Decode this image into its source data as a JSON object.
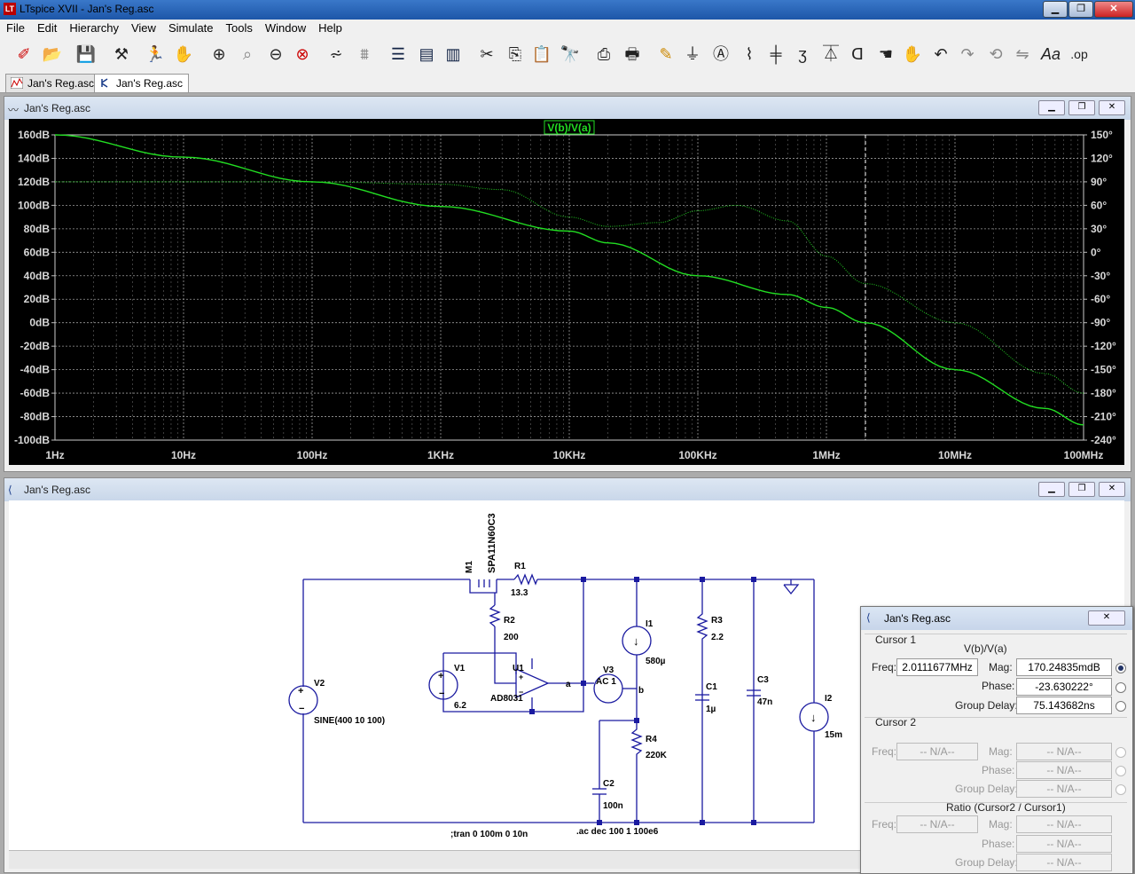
{
  "window": {
    "title": "LTspice XVII - Jan's Reg.asc",
    "app_icon": "LT"
  },
  "menu": [
    "File",
    "Edit",
    "Hierarchy",
    "View",
    "Simulate",
    "Tools",
    "Window",
    "Help"
  ],
  "toolbar_icons": [
    "new-schematic-icon",
    "open-icon",
    "save-icon",
    "control-panel-icon",
    "run-icon",
    "halt-icon",
    "zoom-in-icon",
    "zoom-pan-icon",
    "zoom-out-icon",
    "zoom-cancel-icon",
    "autorange-icon",
    "fft-icon",
    "tile-horizontal-icon",
    "cascade-icon",
    "tile-vertical-icon",
    "cut-icon",
    "copy-icon",
    "paste-icon",
    "find-icon",
    "print-setup-icon",
    "print-icon",
    "draw-wire-icon",
    "ground-icon",
    "label-net-icon",
    "resistor-icon",
    "capacitor-icon",
    "inductor-icon",
    "diode-icon",
    "component-icon",
    "move-icon",
    "drag-icon",
    "undo-icon",
    "redo-icon",
    "rotate-icon",
    "mirror-icon",
    "text-icon",
    "spice-directive-icon"
  ],
  "tabs": [
    {
      "label": "Jan's Reg.asc"
    },
    {
      "label": "Jan's Reg.asc"
    }
  ],
  "plot_window": {
    "title": "Jan's Reg.asc"
  },
  "schematic_window": {
    "title": "Jan's Reg.asc"
  },
  "chart_data": {
    "type": "line",
    "title": "V(b)/V(a)",
    "x_scale": "log",
    "xlim": [
      1,
      100000000
    ],
    "x_ticks": [
      "1Hz",
      "10Hz",
      "100Hz",
      "1KHz",
      "10KHz",
      "100KHz",
      "1MHz",
      "10MHz",
      "100MHz"
    ],
    "y_left_ticks": [
      "160dB",
      "140dB",
      "120dB",
      "100dB",
      "80dB",
      "60dB",
      "40dB",
      "20dB",
      "0dB",
      "-20dB",
      "-40dB",
      "-60dB",
      "-80dB",
      "-100dB"
    ],
    "y_right_ticks": [
      "150°",
      "120°",
      "90°",
      "60°",
      "30°",
      "0°",
      "-30°",
      "-60°",
      "-90°",
      "-120°",
      "-150°",
      "-180°",
      "-210°",
      "-240°"
    ],
    "ylim_left": [
      -100,
      160
    ],
    "ylim_right": [
      -240,
      150
    ],
    "grid": true,
    "cursor_x": 2011167.7,
    "series": [
      {
        "name": "magnitude",
        "axis": "left",
        "style": "solid",
        "color": "#22dd22",
        "x": [
          1,
          10,
          100,
          1000,
          10000,
          20000,
          100000,
          500000,
          1000000,
          2000000,
          10000000,
          50000000,
          100000000
        ],
        "y": [
          160,
          141,
          120,
          99,
          78,
          68,
          40,
          24,
          13,
          0,
          -40,
          -73,
          -87
        ]
      },
      {
        "name": "phase",
        "axis": "right",
        "style": "dotted",
        "color": "#22cc22",
        "x": [
          1,
          10,
          100,
          1000,
          3000,
          10000,
          20000,
          50000,
          100000,
          200000,
          500000,
          1000000,
          2000000,
          10000000,
          50000000,
          100000000
        ],
        "y": [
          90,
          90,
          90,
          87,
          80,
          45,
          33,
          38,
          53,
          60,
          40,
          -5,
          -40,
          -90,
          -155,
          -180
        ]
      }
    ]
  },
  "schematic": {
    "components": [
      {
        "ref": "M1",
        "value": "SPA11N60C3"
      },
      {
        "ref": "R1",
        "value": "13.3"
      },
      {
        "ref": "R2",
        "value": "200"
      },
      {
        "ref": "V1",
        "value": "6.2"
      },
      {
        "ref": "U1",
        "value": "AD8031"
      },
      {
        "ref": "V2",
        "value": "SINE(400 10 100)"
      },
      {
        "ref": "V3",
        "value": "AC 1"
      },
      {
        "ref": "I1",
        "value": "580µ"
      },
      {
        "ref": "R3",
        "value": "2.2"
      },
      {
        "ref": "C1",
        "value": "1µ"
      },
      {
        "ref": "C3",
        "value": "47n"
      },
      {
        "ref": "I2",
        "value": "15m"
      },
      {
        "ref": "R4",
        "value": "220K"
      },
      {
        "ref": "C2",
        "value": "100n"
      }
    ],
    "net_a": "a",
    "net_b": "b",
    "directive_tran": ";tran 0 100m 0 10n",
    "directive_ac": ".ac dec 100 1 100e6"
  },
  "cursor_panel": {
    "title": "Jan's Reg.asc",
    "cursor1_label": "Cursor 1",
    "trace": "V(b)/V(a)",
    "freq_label": "Freq:",
    "freq": "2.0111677MHz",
    "mag_label": "Mag:",
    "mag": "170.24835mdB",
    "phase_label": "Phase:",
    "phase": "-23.630222°",
    "gd_label": "Group Delay:",
    "gd": "75.143682ns",
    "cursor2_label": "Cursor 2",
    "na": "-- N/A--",
    "ratio_label": "Ratio (Cursor2 / Cursor1)"
  }
}
